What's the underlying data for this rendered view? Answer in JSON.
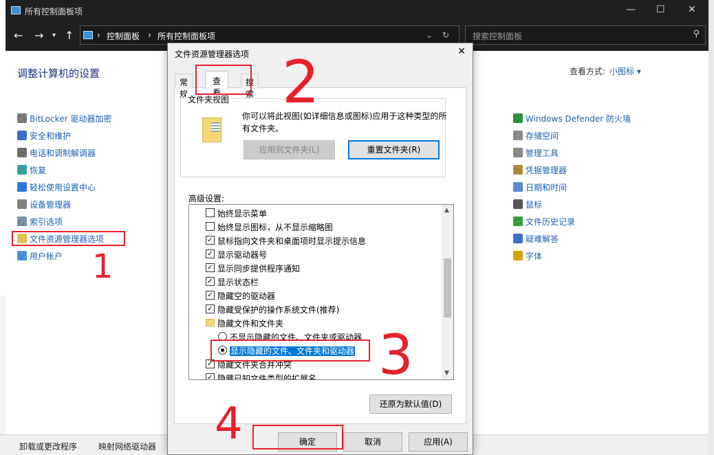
{
  "window": {
    "title": "所有控制面板项",
    "breadcrumb": [
      "控制面板",
      "所有控制面板项"
    ],
    "search_placeholder": "搜索控制面板",
    "min_glyph": "—",
    "max_glyph": "☐",
    "close_glyph": "✕"
  },
  "content": {
    "heading": "调整计算机的设置",
    "view_by_label": "查看方式:",
    "view_by_value": "小图标 ▾",
    "left_items": [
      "BitLocker 驱动器加密",
      "安全和维护",
      "电话和调制解调器",
      "恢复",
      "轻松使用设置中心",
      "设备管理器",
      "索引选项",
      "文件资源管理器选项",
      "用户帐户"
    ],
    "right_items": [
      "Windows Defender 防火墙",
      "存储空间",
      "管理工具",
      "凭据管理器",
      "日期和时间",
      "鼠标",
      "文件历史记录",
      "疑难解答",
      "字体"
    ],
    "bottom_links": [
      "卸载或更改程序",
      "映射网络驱动器"
    ]
  },
  "dialog": {
    "title": "文件资源管理器选项",
    "close_glyph": "✕",
    "tabs": [
      "常规",
      "查看",
      "搜索"
    ],
    "selected_tab": "查看",
    "folder_views_caption": "文件夹视图",
    "folder_views_desc": "你可以将此视图(如详细信息或图标)应用于这种类型的所有文件夹。",
    "apply_to_folders": "应用到文件夹(L)",
    "reset_folders": "重置文件夹(R)",
    "advanced_label": "高级设置:",
    "settings": [
      {
        "type": "checkbox",
        "checked": false,
        "label": "始终显示菜单"
      },
      {
        "type": "checkbox",
        "checked": false,
        "label": "始终显示图标，从不显示缩略图"
      },
      {
        "type": "checkbox",
        "checked": true,
        "label": "鼠标指向文件夹和桌面项时显示提示信息"
      },
      {
        "type": "checkbox",
        "checked": true,
        "label": "显示驱动器号"
      },
      {
        "type": "checkbox",
        "checked": true,
        "label": "显示同步提供程序通知"
      },
      {
        "type": "checkbox",
        "checked": true,
        "label": "显示状态栏"
      },
      {
        "type": "checkbox",
        "checked": true,
        "label": "隐藏空的驱动器"
      },
      {
        "type": "checkbox",
        "checked": true,
        "label": "隐藏受保护的操作系统文件(推荐)"
      },
      {
        "type": "folder",
        "label": "隐藏文件和文件夹"
      },
      {
        "type": "radio",
        "checked": false,
        "label": "不显示隐藏的文件、文件夹或驱动器"
      },
      {
        "type": "radio",
        "checked": true,
        "label": "显示隐藏的文件、文件夹和驱动器"
      },
      {
        "type": "checkbox",
        "checked": true,
        "label": "隐藏文件夹合并冲突"
      },
      {
        "type": "checkbox",
        "checked": true,
        "label": "隐藏已知文件类型的扩展名"
      }
    ],
    "restore_defaults": "还原为默认值(D)",
    "ok": "确定",
    "cancel": "取消",
    "apply": "应用(A)"
  },
  "annotations": [
    "1",
    "2",
    "3",
    "4"
  ],
  "colors": {
    "annotation": "#e8202a",
    "link": "#1a5fb4",
    "accent": "#0078d7",
    "titlebar": "#1f1f1f"
  }
}
